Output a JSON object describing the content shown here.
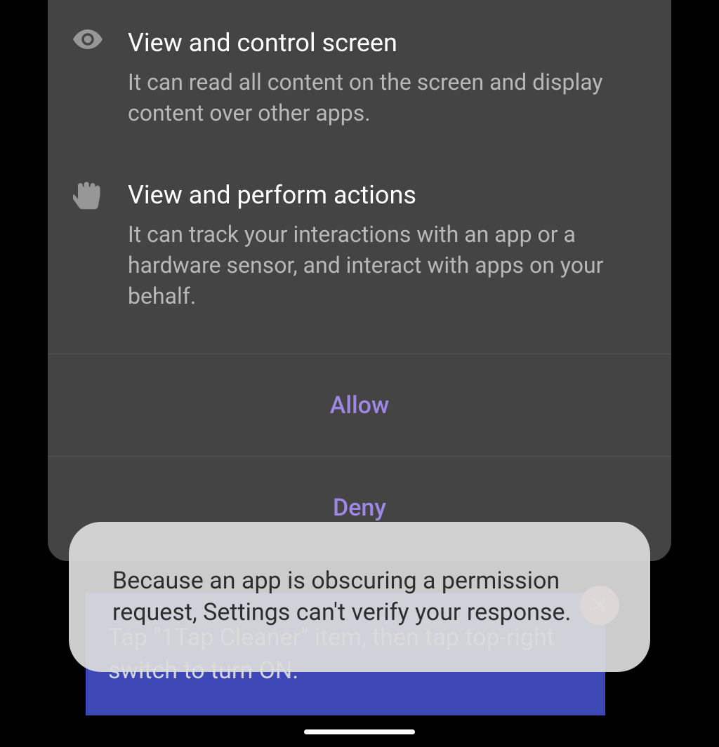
{
  "permissions": [
    {
      "title": "View and control screen",
      "description": "It can read all content on the screen and display content over other apps."
    },
    {
      "title": "View and perform actions",
      "description": "It can track your interactions with an app or a hardware sensor, and interact with apps on your behalf."
    }
  ],
  "buttons": {
    "allow": "Allow",
    "deny": "Deny"
  },
  "tooltip": {
    "text": "Tap \"1Tap Cleaner\" item, then tap top-right switch to turn ON."
  },
  "toast": {
    "text": "Because an app is obscuring a permission request, Settings can't verify your response."
  }
}
